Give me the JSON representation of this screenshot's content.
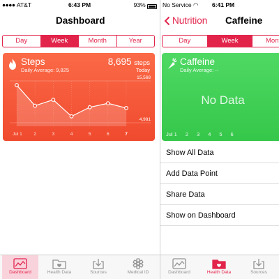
{
  "left": {
    "status": {
      "carrier": "AT&T",
      "time": "6:43 PM",
      "battery": "93%"
    },
    "nav_title": "Dashboard",
    "segments": [
      "Day",
      "Week",
      "Month",
      "Year"
    ],
    "active_segment": "Week",
    "card": {
      "title": "Steps",
      "subtitle": "Daily Average: 9,825",
      "value": "8,695",
      "unit": "steps",
      "period": "Today",
      "max_label": "15,568",
      "min_label": "4,981",
      "color_top": "#fb6a47",
      "color_bottom": "#f04a2e"
    },
    "chart_data": {
      "type": "line",
      "categories": [
        "Jul 1",
        "2",
        "3",
        "4",
        "5",
        "6",
        "7"
      ],
      "values": [
        14500,
        9300,
        10800,
        6600,
        8900,
        9900,
        8695
      ],
      "ylim": [
        4981,
        15568
      ],
      "highlighted_category": "7"
    },
    "tabs": [
      "Dashboard",
      "Health Data",
      "Sources",
      "Medical ID"
    ],
    "active_tab": "Dashboard"
  },
  "right": {
    "status": {
      "carrier": "No Service",
      "time": "6:41 PM"
    },
    "back_label": "Nutrition",
    "nav_title": "Caffeine",
    "segments": [
      "Day",
      "Week",
      "Month"
    ],
    "active_segment": "Week",
    "card": {
      "title": "Caffeine",
      "subtitle": "Daily Average: --",
      "no_data": "No Data",
      "x_labels": [
        "Jul 1",
        "2",
        "3",
        "4",
        "5",
        "6"
      ],
      "color": "#4cd964"
    },
    "list": [
      "Show All Data",
      "Add Data Point",
      "Share Data",
      "Show on Dashboard"
    ],
    "tabs": [
      "Dashboard",
      "Health Data",
      "Sources"
    ],
    "active_tab": "Health Data"
  },
  "accent_color": "#e2244b",
  "icons": {
    "steps": "flame-icon",
    "caffeine": "carrot-icon",
    "dashboard": "dashboard-chart-icon",
    "health_data": "folder-heart-icon",
    "sources": "download-tray-icon",
    "medical_id": "asterisk-icon",
    "back": "chevron-left-icon"
  }
}
